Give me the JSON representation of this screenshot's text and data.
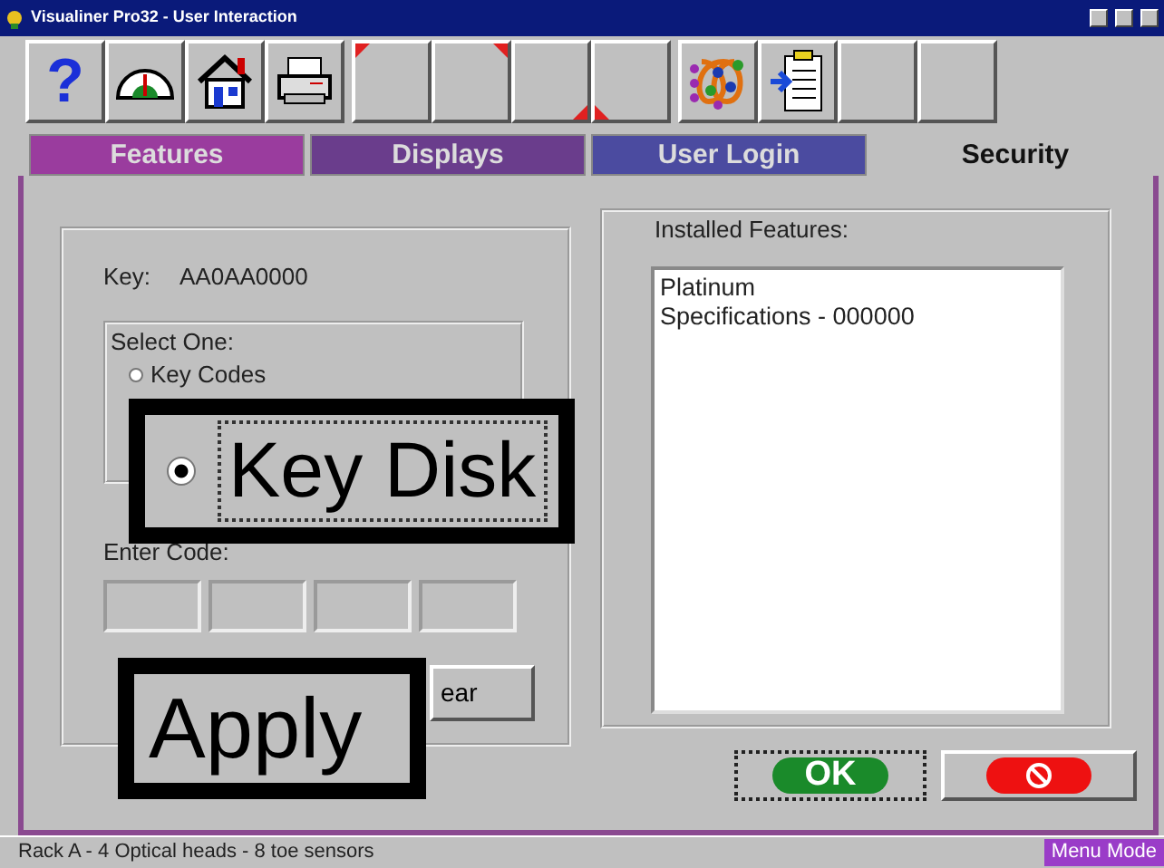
{
  "window": {
    "title": "Visualiner Pro32  -  User Interaction"
  },
  "toolbar": {
    "help_label": "?"
  },
  "tabs": [
    {
      "label": "Features",
      "selected": false,
      "color": "#9a3c9e"
    },
    {
      "label": "Displays",
      "selected": false,
      "color": "#6a3d8c"
    },
    {
      "label": "User Login",
      "selected": false,
      "color": "#4b4ba0"
    },
    {
      "label": "Security",
      "selected": true,
      "color": "#c0c0c0"
    }
  ],
  "key": {
    "label": "Key:",
    "value": "AA0AA0000"
  },
  "select_one": {
    "legend": "Select One:",
    "options": [
      {
        "label": "Key Codes",
        "selected": false
      },
      {
        "label": "Key Disk",
        "selected": true
      }
    ]
  },
  "enter_code": {
    "label": "Enter Code:"
  },
  "apply_button": "Apply",
  "clear_button": "ear",
  "installed_features": {
    "title": "Installed Features:",
    "items": [
      "Platinum",
      "Specifications - 000000"
    ]
  },
  "ok_button": "OK",
  "status_bar": {
    "text": "Rack A - 4 Optical heads - 8 toe sensors",
    "mode": "Menu Mode"
  }
}
